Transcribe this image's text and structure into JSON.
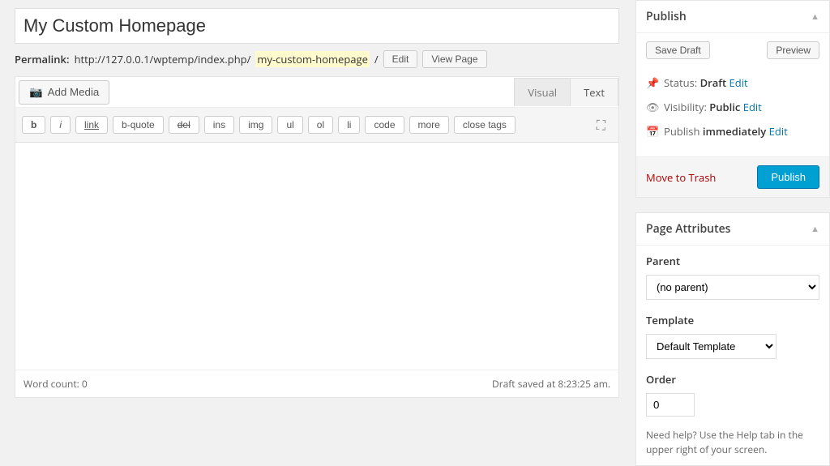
{
  "title": "My Custom Homepage",
  "permalink": {
    "label": "Permalink:",
    "base": "http://127.0.0.1/wptemp/index.php/",
    "slug": "my-custom-homepage",
    "trail": "/",
    "edit": "Edit",
    "view": "View Page"
  },
  "addMedia": "Add Media",
  "tabs": {
    "visual": "Visual",
    "text": "Text"
  },
  "toolbar": [
    "b",
    "i",
    "link",
    "b-quote",
    "del",
    "ins",
    "img",
    "ul",
    "ol",
    "li",
    "code",
    "more",
    "close tags"
  ],
  "status": {
    "wordCountLabel": "Word count:",
    "wordCount": "0",
    "saved": "Draft saved at 8:23:25 am."
  },
  "publish": {
    "title": "Publish",
    "saveDraft": "Save Draft",
    "preview": "Preview",
    "statusLabel": "Status:",
    "statusValue": "Draft",
    "visibilityLabel": "Visibility:",
    "visibilityValue": "Public",
    "publishLabel": "Publish",
    "publishValue": "immediately",
    "edit": "Edit",
    "trash": "Move to Trash",
    "button": "Publish"
  },
  "attrs": {
    "title": "Page Attributes",
    "parentLabel": "Parent",
    "parentValue": "(no parent)",
    "templateLabel": "Template",
    "templateValue": "Default Template",
    "orderLabel": "Order",
    "orderValue": "0",
    "help": "Need help? Use the Help tab in the upper right of your screen."
  }
}
